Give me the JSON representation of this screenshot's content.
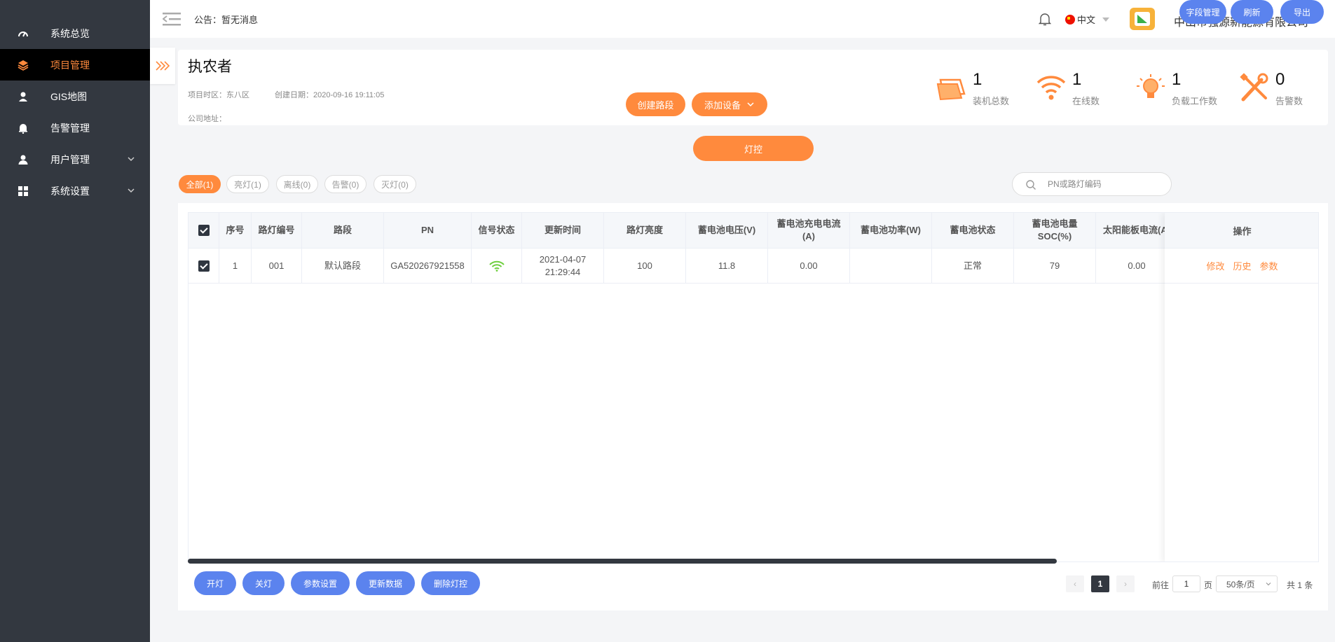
{
  "sidebar": {
    "items": [
      {
        "label": "系统总览",
        "icon": "dashboard-icon"
      },
      {
        "label": "项目管理",
        "icon": "layers-icon",
        "active": true
      },
      {
        "label": "GIS地图",
        "icon": "map-user-icon"
      },
      {
        "label": "告警管理",
        "icon": "bell-icon"
      },
      {
        "label": "用户管理",
        "icon": "user-icon",
        "expandable": true
      },
      {
        "label": "系统设置",
        "icon": "grid-icon",
        "expandable": true
      }
    ]
  },
  "header": {
    "notice": "公告：暂无消息",
    "language": "中文",
    "company": "中山市强源新能源有限公司"
  },
  "project": {
    "title": "执农者",
    "timezone_label": "项目时区：东八区",
    "created_label": "创建日期：2020-09-16 19:11:05",
    "address_label": "公司地址：",
    "create_road_btn": "创建路段",
    "add_device_btn": "添加设备",
    "light_control_btn": "灯控"
  },
  "stats": [
    {
      "value": "1",
      "label": "装机总数",
      "icon": "solar-panel-icon"
    },
    {
      "value": "1",
      "label": "在线数",
      "icon": "wifi-icon"
    },
    {
      "value": "1",
      "label": "负载工作数",
      "icon": "lightbulb-icon"
    },
    {
      "value": "0",
      "label": "告警数",
      "icon": "tools-icon"
    }
  ],
  "filters": [
    {
      "label": "全部(1)",
      "active": true
    },
    {
      "label": "亮灯(1)"
    },
    {
      "label": "离线(0)"
    },
    {
      "label": "告警(0)"
    },
    {
      "label": "灭灯(0)"
    }
  ],
  "search": {
    "placeholder": "PN或路灯编码"
  },
  "toolbar": {
    "field_mgmt": "字段管理",
    "refresh": "刷新",
    "export": "导出"
  },
  "table": {
    "columns": [
      "序号",
      "路灯编号",
      "路段",
      "PN",
      "信号状态",
      "更新时间",
      "路灯亮度",
      "蓄电池电压(V)",
      "蓄电池充电电流(A)",
      "蓄电池功率(W)",
      "蓄电池状态",
      "蓄电池电量SOC(%)",
      "太阳能板电流(A)"
    ],
    "op_column": "操作",
    "rows": [
      {
        "index": "1",
        "lamp_no": "001",
        "road": "默认路段",
        "pn": "GA520267921558",
        "signal": "wifi-signal-icon",
        "update_date": "2021-04-07",
        "update_time": "21:29:44",
        "brightness": "100",
        "battery_voltage": "11.8",
        "charge_current": "0.00",
        "battery_power": "",
        "battery_status": "正常",
        "soc": "79",
        "solar_current": "0.00",
        "ops": [
          "修改",
          "历史",
          "参数"
        ]
      }
    ]
  },
  "actions": {
    "on": "开灯",
    "off": "关灯",
    "params": "参数设置",
    "update": "更新数据",
    "delete": "删除灯控"
  },
  "pagination": {
    "current_page": "1",
    "goto_prefix": "前往",
    "goto_value": "1",
    "page_suffix": "页",
    "page_size": "50条/页",
    "total": "共 1 条"
  },
  "colors": {
    "accent": "#ff8a3d",
    "primary": "#5b83ee",
    "sidebar": "#333840",
    "signal": "#6fcf3f"
  }
}
